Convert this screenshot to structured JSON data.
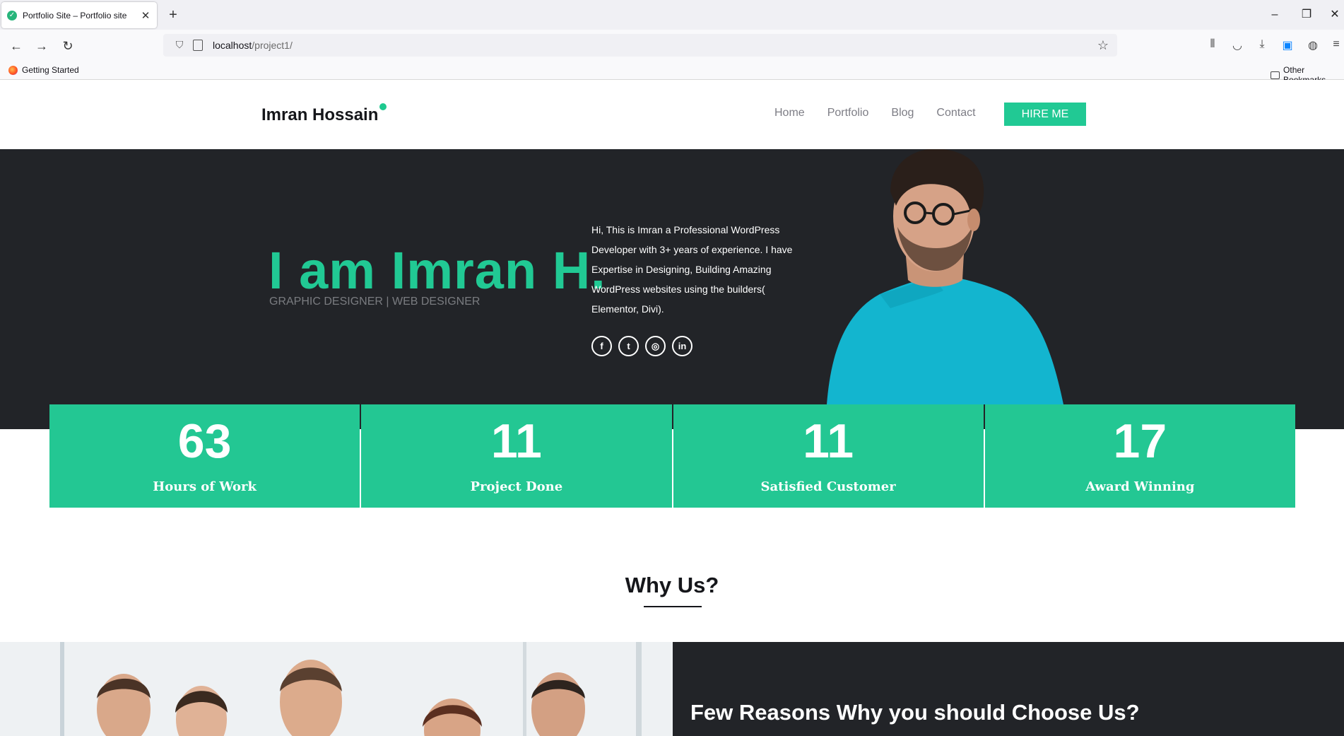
{
  "browser": {
    "tab_title": "Portfolio Site – Portfolio site",
    "url_host": "localhost",
    "url_path": "/project1/",
    "bookmarks": [
      "Getting Started",
      "Other Bookmarks"
    ]
  },
  "header": {
    "logo": "Imran Hossain",
    "menu": [
      "Home",
      "Portfolio",
      "Blog",
      "Contact"
    ],
    "hire_label": "HIRE ME"
  },
  "hero": {
    "title": "I am Imran H.",
    "subtitle": "GRAPHIC DESIGNER | WEB DESIGNER",
    "bio": "Hi, This is Imran a Professional WordPress Developer with 3+ years of experience. I have Expertise in Designing, Building Amazing WordPress websites using the builders( Elementor, Divi).",
    "socials": [
      "facebook-icon",
      "twitter-icon",
      "instagram-icon",
      "linkedin-icon"
    ]
  },
  "stats": [
    {
      "value": "63",
      "label": "Hours of Work"
    },
    {
      "value": "11",
      "label": "Project Done"
    },
    {
      "value": "11",
      "label": "Satisfied Customer"
    },
    {
      "value": "17",
      "label": "Award Winning"
    }
  ],
  "why": {
    "title": "Why Us?",
    "reasons_title": "Few Reasons Why you should Choose Us?"
  },
  "colors": {
    "accent": "#21c994",
    "dark": "#222428"
  }
}
